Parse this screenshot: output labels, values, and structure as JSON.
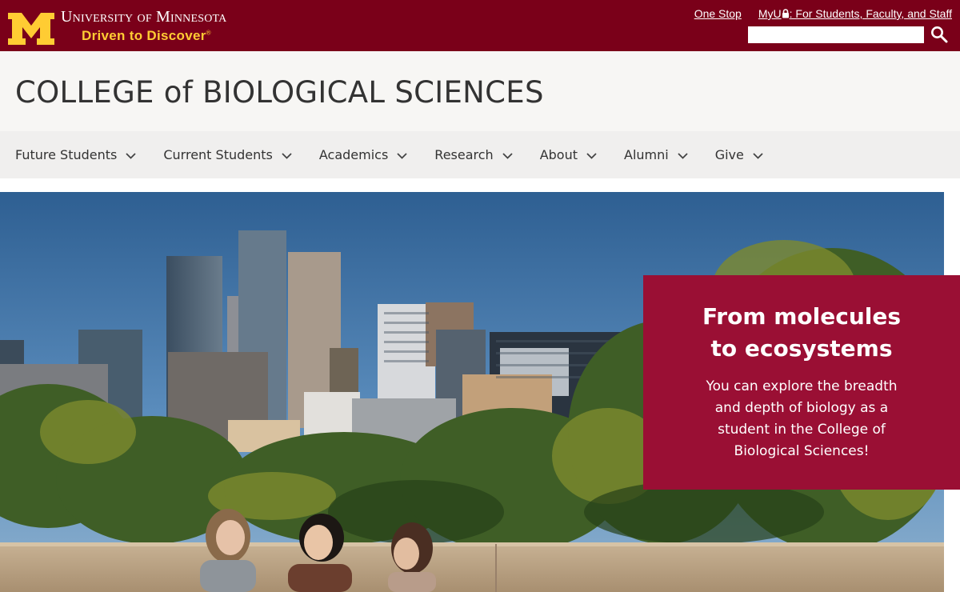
{
  "header": {
    "university_name": "University of Minnesota",
    "tagline": "Driven to Discover",
    "tagline_mark": "®",
    "links": {
      "one_stop": "One Stop",
      "myu_prefix": "MyU",
      "myu_suffix": ": For Students, Faculty, and Staff"
    },
    "search": {
      "value": "",
      "placeholder": ""
    },
    "colors": {
      "maroon": "#7a0019",
      "gold": "#ffcc33"
    }
  },
  "college": {
    "title": "COLLEGE of BIOLOGICAL SCIENCES"
  },
  "nav": {
    "items": [
      {
        "label": "Future Students"
      },
      {
        "label": "Current Students"
      },
      {
        "label": "Academics"
      },
      {
        "label": "Research"
      },
      {
        "label": "About"
      },
      {
        "label": "Alumni"
      },
      {
        "label": "Give"
      }
    ]
  },
  "hero": {
    "image": "Minneapolis skyline with trees and three students on a rooftop terrace",
    "promo": {
      "heading_line1": "From molecules",
      "heading_line2": "to ecosystems",
      "body": "You can explore the breadth and depth of biology as a student in the College of Biological Sciences!",
      "background": "#9a0f34"
    }
  },
  "icons": {
    "logo": "block-m-logo-icon",
    "lock": "lock-icon",
    "search": "search-icon",
    "chevron": "chevron-down-icon"
  }
}
